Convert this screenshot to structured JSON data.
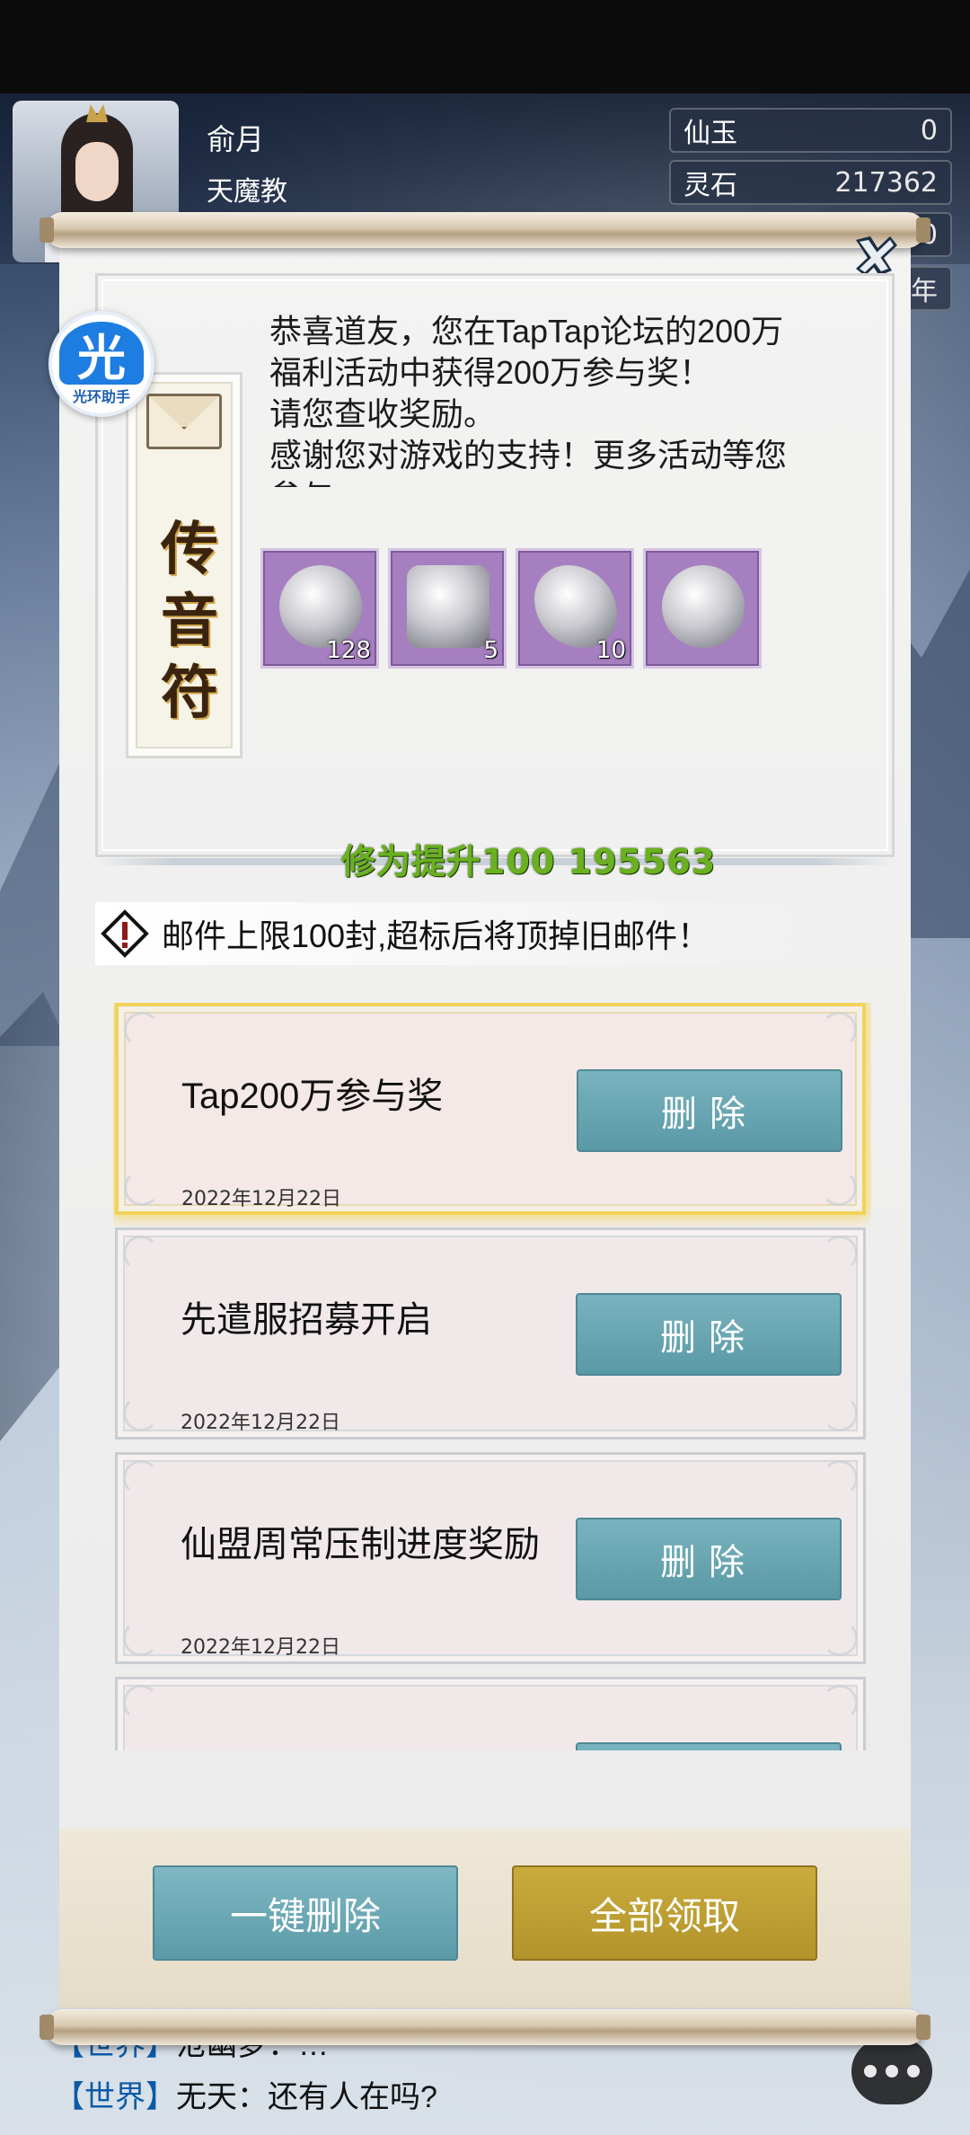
{
  "player": {
    "name": "俞月",
    "sect": "天魔教"
  },
  "resources": [
    {
      "label": "仙玉",
      "value": "0"
    },
    {
      "label": "灵石",
      "value": "217362"
    }
  ],
  "partial_boxes": [
    {
      "text": "0"
    },
    {
      "text": "年"
    }
  ],
  "helper": {
    "glyph": "光",
    "label": "光环助手"
  },
  "letter": {
    "seal_chars": [
      "传",
      "音",
      "符"
    ],
    "lines": [
      "恭喜道友，您在TapTap论坛的200万",
      "福利活动中获得200万参与奖！",
      "请您查收奖励。",
      "感谢您对游戏的支持！更多活动等您",
      "参与"
    ],
    "rewards": [
      {
        "item": "white-feather",
        "count": "128"
      },
      {
        "item": "phoenix-talisman",
        "count": "5"
      },
      {
        "item": "dragon-pendant",
        "count": "10"
      },
      {
        "item": "crystal-orb-stand",
        "count": ""
      }
    ]
  },
  "floating_text": "修为提升100 195563",
  "notice": "邮件上限100封,超标后将顶掉旧邮件！",
  "mails": [
    {
      "title": "Tap200万参与奖",
      "date": "2022年12月22日",
      "button": "删除",
      "selected": true
    },
    {
      "title": "先遣服招募开启",
      "date": "2022年12月22日",
      "button": "删除",
      "selected": false
    },
    {
      "title": "仙盟周常压制进度奖励",
      "date": "2022年12月22日",
      "button": "删除",
      "selected": false
    },
    {
      "title": "",
      "date": "",
      "button": "",
      "selected": false
    }
  ],
  "actions": {
    "delete_all": "一键删除",
    "claim_all": "全部领取"
  },
  "chat": [
    {
      "channel": "【世界】",
      "text": "沧幽梦：…"
    },
    {
      "channel": "【世界】",
      "text": "无天：还有人在吗?"
    }
  ],
  "colors": {
    "delete_button": "#5a99a6",
    "claim_button": "#b3942b",
    "reward_bg": "#a67fc0",
    "floating_text": "#69b11f",
    "selected_border": "#f2d35a"
  }
}
